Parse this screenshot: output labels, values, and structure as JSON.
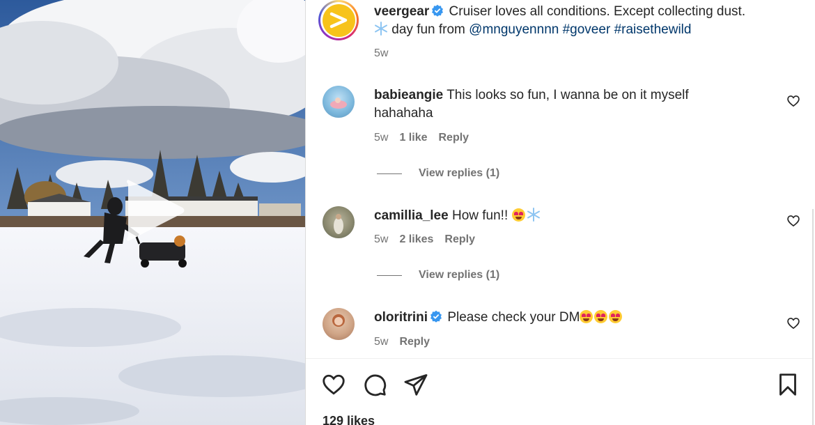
{
  "post": {
    "author": "veergear",
    "author_verified": true,
    "caption_line1": "Cruiser loves all conditions. Except collecting dust.",
    "caption_line2_text": "day fun from",
    "caption_mention": "@mnguyennnn",
    "caption_tags": [
      "#goveer",
      "#raisethewild"
    ],
    "caption_snow_emoji": "❄️",
    "time": "5w",
    "likes_text": "129 likes"
  },
  "comments": [
    {
      "username": "babieangie",
      "verified": false,
      "text_line1": "This looks so fun, I wanna be on it myself",
      "text_line2": "hahahaha",
      "time": "5w",
      "likes": "1 like",
      "reply_label": "Reply",
      "view_replies": "View replies (1)"
    },
    {
      "username": "camillia_lee",
      "verified": false,
      "text": "How fun!!",
      "emoji": [
        "😍",
        "❄️"
      ],
      "time": "5w",
      "likes": "2 likes",
      "reply_label": "Reply",
      "view_replies": "View replies (1)"
    },
    {
      "username": "oloritrini",
      "verified": true,
      "text": "Please check your DM",
      "emoji": [
        "😍",
        "😍",
        "😍"
      ],
      "time": "5w",
      "reply_label": "Reply"
    }
  ],
  "actions": {
    "icons": [
      "heart-icon",
      "comment-icon",
      "share-icon",
      "bookmark-icon"
    ]
  },
  "colors": {
    "verified_blue": "#3897f0",
    "link_blue": "#00376b",
    "meta_gray": "#737373",
    "brand_yellow": "#f7c31b"
  }
}
